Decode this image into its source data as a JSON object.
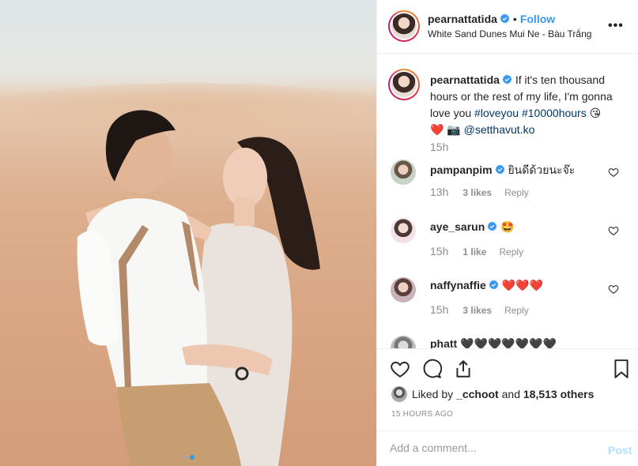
{
  "post": {
    "username": "pearnattatida",
    "follow_label": "Follow",
    "dot": "•",
    "location": "White Sand Dunes Mui Ne - Bàu Trắng",
    "more_label": "•••"
  },
  "caption": {
    "username": "pearnattatida",
    "text": "If it's ten thousand hours or the rest of my life, I'm gonna love you",
    "tags": "#loveyou #10000hours",
    "emoji_kiss": "😘",
    "emoji_line2": "❤️ 📷",
    "mention": "@setthavut.ko",
    "time": "15h"
  },
  "comments": [
    {
      "username": "pampanpim",
      "text": "ยินดีด้วยนะจ๊ะ",
      "time": "13h",
      "likes": "3 likes",
      "reply": "Reply"
    },
    {
      "username": "aye_sarun",
      "text": "🤩",
      "time": "15h",
      "likes": "1 like",
      "reply": "Reply"
    },
    {
      "username": "naffynaffie",
      "text": "❤️❤️❤️",
      "time": "15h",
      "likes": "3 likes",
      "reply": "Reply"
    },
    {
      "username": "phatt",
      "text": "🖤🖤🖤🖤🖤🖤🖤"
    }
  ],
  "likes": {
    "prefix": "Liked by",
    "user": "_cchoot",
    "middle": "and",
    "count": "18,513 others"
  },
  "time_ago": "15 HOURS AGO",
  "add_comment": {
    "placeholder": "Add a comment...",
    "post_label": "Post"
  },
  "colors": {
    "link": "#3897f0",
    "tag": "#003569",
    "verified": "#3897f0",
    "post_disabled": "#b2dffc",
    "muted": "#8e8e8e"
  },
  "icons": {
    "like": "heart-outline-icon",
    "comment": "comment-bubble-icon",
    "share": "share-icon",
    "save": "bookmark-icon",
    "verified": "verified-badge-icon",
    "carousel": "carousel-dots-icon"
  },
  "carousel": {
    "count": 2,
    "active_index": 1
  }
}
